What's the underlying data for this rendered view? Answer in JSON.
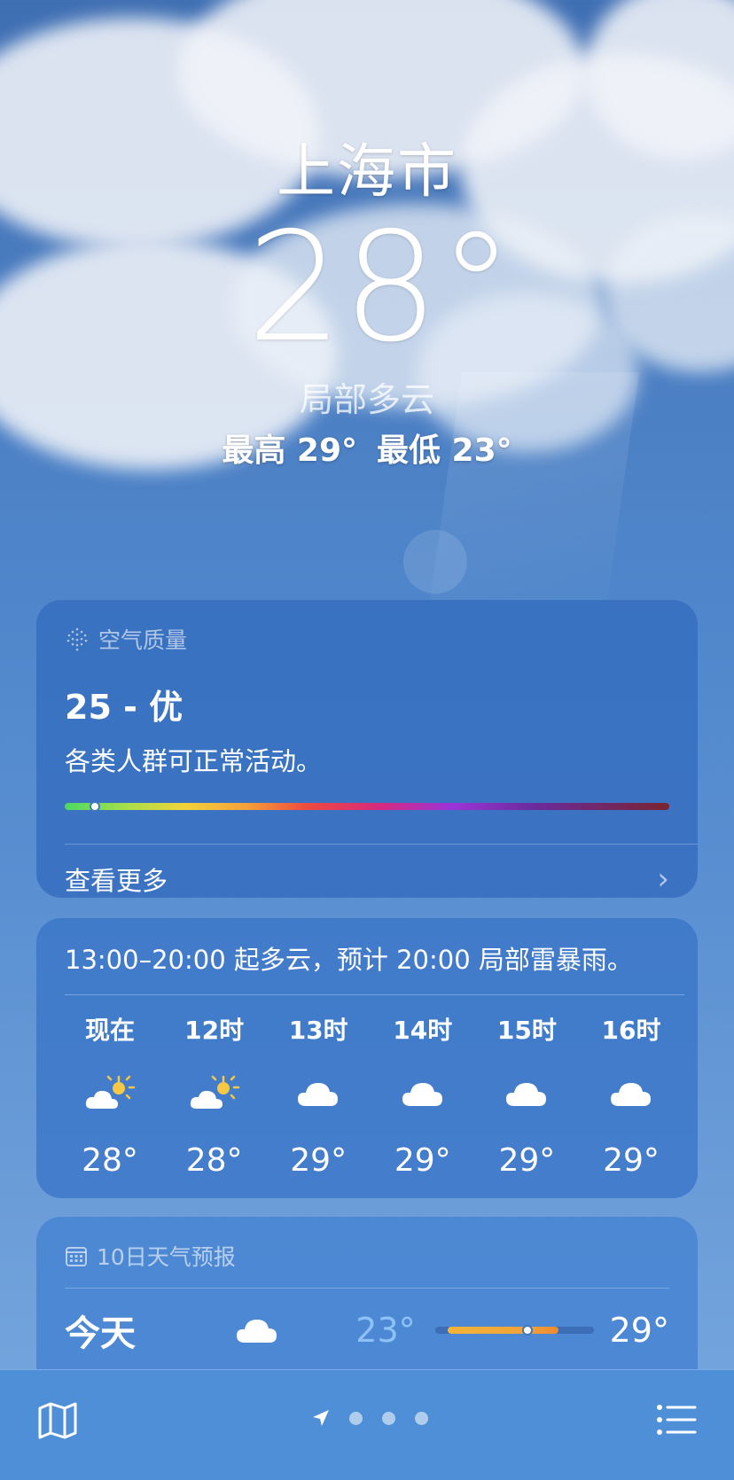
{
  "location": {
    "city": "上海市",
    "temperature": "28°",
    "condition": "局部多云",
    "high": "最高 29°",
    "low": "最低 23°"
  },
  "air_quality": {
    "title": "空气质量",
    "value": "25 - 优",
    "description": "各类人群可正常活动。",
    "index_fraction": 0.05,
    "more_label": "查看更多"
  },
  "hourly": {
    "summary": "13:00–20:00 起多云，预计 20:00 局部雷暴雨。",
    "items": [
      {
        "label": "现在",
        "icon": "partly-sunny-icon",
        "temp": "28°"
      },
      {
        "label": "12时",
        "icon": "partly-sunny-icon",
        "temp": "28°"
      },
      {
        "label": "13时",
        "icon": "cloud-icon",
        "temp": "29°"
      },
      {
        "label": "14时",
        "icon": "cloud-icon",
        "temp": "29°"
      },
      {
        "label": "15时",
        "icon": "cloud-icon",
        "temp": "29°"
      },
      {
        "label": "16时",
        "icon": "cloud-icon",
        "temp": "29°"
      }
    ]
  },
  "forecast": {
    "title": "10日天气预报",
    "days": [
      {
        "name": "今天",
        "icon": "cloud-icon",
        "low": "23°",
        "high": "29°"
      }
    ]
  },
  "tabbar": {
    "map_icon": "map-icon",
    "location_icon": "location-arrow-icon",
    "page_dots": 3,
    "list_icon": "list-icon"
  },
  "colors": {
    "sky_top": "#3f6fb3",
    "sky_bottom": "#78a8de",
    "low_temp": "#8ec2f7",
    "tabbar": "#4f8fd8"
  }
}
